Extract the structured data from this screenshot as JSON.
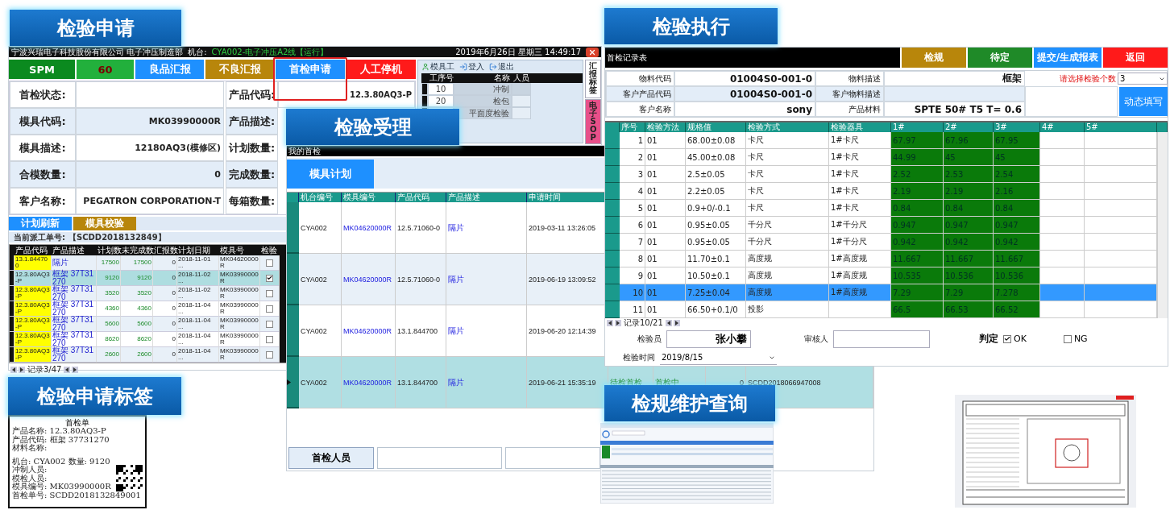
{
  "apply_screen": {
    "label": "检验申请",
    "company": "宁波兴瑞电子科技股份有限公司  电子冲压制造部",
    "machine_label": "机台:",
    "machine": "CYA002-电子冲压A2线【运行】",
    "datetime": "2019年6月26日 星期三 14:49:17",
    "actions": [
      {
        "text": "SPM",
        "kind": "status",
        "highlighted": false
      },
      {
        "text": "60",
        "kind": "value",
        "highlighted": false
      },
      {
        "text": "良品汇报",
        "kind": "good",
        "highlighted": false
      },
      {
        "text": "不良汇报",
        "kind": "bad",
        "highlighted": false
      },
      {
        "text": "首检申请",
        "kind": "apply",
        "highlighted": true
      },
      {
        "text": "人工停机",
        "kind": "stop",
        "highlighted": false
      }
    ],
    "info_left": [
      {
        "label": "首检状态:"
      },
      {
        "label": "模具代码:",
        "value": "MK03990000R"
      },
      {
        "label": "模具描述:",
        "value": "12180AQ3(模修区)"
      },
      {
        "label": "合模数量:",
        "value": "0"
      },
      {
        "label": "客户名称:",
        "value": "PEGATRON CORPORATION-T"
      }
    ],
    "info_right": [
      {
        "label": "产品代码:",
        "value": "12.3.80AQ3-P"
      },
      {
        "label": "产品描述:"
      },
      {
        "label": "计划数量:"
      },
      {
        "label": "完成数量:"
      },
      {
        "label": "每箱数量:"
      }
    ],
    "process_panel": {
      "toolbar": [
        "模具工",
        "登入",
        "退出"
      ],
      "columns": [
        "工序号",
        "名称",
        "人员"
      ],
      "rows": [
        {
          "step": "10",
          "name": "冲制"
        },
        {
          "step": "20",
          "name": "检包"
        },
        {
          "name": "平面度检验"
        }
      ]
    },
    "side_tabs": [
      {
        "text": "汇报标签",
        "color": "#ffffff"
      },
      {
        "text": "电子SOP",
        "color": "#e8508a"
      }
    ],
    "plan_buttons": [
      {
        "text": "计划刷新",
        "kind": "refresh"
      },
      {
        "text": "模具校验",
        "kind": "check"
      }
    ],
    "dispatch_label": "当前派工单号:",
    "dispatch_no": "【SCDD2018132849】",
    "plan_columns": [
      "产品代码",
      "产品描述",
      "计划数",
      "未完成数",
      "汇报数",
      "计划日期",
      "模具号",
      "检验"
    ],
    "plan_rows": [
      {
        "code": "13.1.844700",
        "desc": "隔片",
        "plan": "17500",
        "remaining": "17500",
        "reported": "0",
        "date": "2018-11-01 ...",
        "mold": "MK04620000R",
        "checked": false,
        "selected": false
      },
      {
        "code": "12.3.80AQ3-P",
        "desc": "框架 37T31270",
        "plan": "9120",
        "remaining": "9120",
        "reported": "0",
        "date": "2018-11-02 ...",
        "mold": "MK03990000R",
        "checked": true,
        "selected": true
      },
      {
        "code": "12.3.80AQ3-P",
        "desc": "框架 37T31270",
        "plan": "3520",
        "remaining": "3520",
        "reported": "0",
        "date": "2018-11-02 ...",
        "mold": "MK03990000R",
        "checked": false,
        "selected": false
      },
      {
        "code": "12.3.80AQ3-P",
        "desc": "框架 37T31270",
        "plan": "4360",
        "remaining": "4360",
        "reported": "0",
        "date": "2018-11-04 ...",
        "mold": "MK03990000R",
        "checked": false,
        "selected": false
      },
      {
        "code": "12.3.80AQ3-P",
        "desc": "框架 37T31270",
        "plan": "5600",
        "remaining": "5600",
        "reported": "0",
        "date": "2018-11-04 ...",
        "mold": "MK03990000R",
        "checked": false,
        "selected": false
      },
      {
        "code": "12.3.80AQ3-P",
        "desc": "框架 37T31270",
        "plan": "8620",
        "remaining": "8620",
        "reported": "0",
        "date": "2018-11-04 ...",
        "mold": "MK03990000R",
        "checked": false,
        "selected": false
      },
      {
        "code": "12.3.80AQ3-P",
        "desc": "框架 37T31270",
        "plan": "2600",
        "remaining": "2600",
        "reported": "0",
        "date": "2018-11-04 ...",
        "mold": "MK03990000R",
        "checked": false,
        "selected": false
      }
    ],
    "pager": "记录3/47"
  },
  "accept_screen": {
    "label": "检验受理",
    "title": "我的首检",
    "tab": "模具计划",
    "columns": [
      "机台编号",
      "模具编号",
      "产品代码",
      "产品描述",
      "申请时间"
    ],
    "rows": [
      {
        "machine": "CYA002",
        "mold": "MK04620000R",
        "code": "12.5.71060-0",
        "desc": "隔片",
        "time": "2019-03-11 13:26:05",
        "selected": false
      },
      {
        "machine": "CYA002",
        "mold": "MK04620000R",
        "code": "12.5.71060-0",
        "desc": "隔片",
        "time": "2019-06-19 13:09:52",
        "selected": false
      },
      {
        "machine": "CYA002",
        "mold": "MK04620000R",
        "code": "13.1.844700",
        "desc": "隔片",
        "time": "2019-06-20 12:14:39",
        "selected": false
      },
      {
        "machine": "CYA002",
        "mold": "MK04620000R",
        "code": "13.1.844700",
        "desc": "隔片",
        "time": "2019-06-21 15:35:19",
        "selected": true,
        "extra": [
          "待检首检",
          "首检中",
          "0",
          "SCDD2018066947008"
        ]
      }
    ],
    "inspector_button": "首检人员"
  },
  "exec_screen": {
    "label": "检验执行",
    "title": "首检记录表",
    "buttons": [
      {
        "text": "检规",
        "kind": "gauge"
      },
      {
        "text": "待定",
        "kind": "pending"
      },
      {
        "text": "提交/生成报表",
        "kind": "submit"
      },
      {
        "text": "返回",
        "kind": "back"
      }
    ],
    "info": [
      {
        "label": "物料代码",
        "value": "01004S0-001-0",
        "label2": "物料描述",
        "value2": "框架"
      },
      {
        "label": "客户产品代码",
        "value": "01004S0-001-0",
        "label2": "客户物料描述"
      },
      {
        "label": "客户名称",
        "value": "sony",
        "label2": "产品材料",
        "value2": "SPTE  50# T5  T= 0.6"
      }
    ],
    "count_label": "请选择检验个数",
    "count_value": "3",
    "fill_button": "动态填写",
    "columns": [
      "序号",
      "检验方法",
      "规格值",
      "检验方式",
      "检验器具",
      "1#",
      "2#",
      "3#",
      "4#",
      "5#"
    ],
    "rows": [
      {
        "no": "1",
        "method": "01",
        "spec": "68.00±0.08",
        "way": "卡尺",
        "tool": "1#卡尺",
        "values": [
          "67.97",
          "67.96",
          "67.95"
        ],
        "selected": false
      },
      {
        "no": "2",
        "method": "01",
        "spec": "45.00±0.08",
        "way": "卡尺",
        "tool": "1#卡尺",
        "values": [
          "44.99",
          "45",
          "45"
        ],
        "selected": false
      },
      {
        "no": "3",
        "method": "01",
        "spec": "2.5±0.05",
        "way": "卡尺",
        "tool": "1#卡尺",
        "values": [
          "2.52",
          "2.53",
          "2.54"
        ],
        "selected": false
      },
      {
        "no": "4",
        "method": "01",
        "spec": "2.2±0.05",
        "way": "卡尺",
        "tool": "1#卡尺",
        "values": [
          "2.19",
          "2.19",
          "2.16"
        ],
        "selected": false
      },
      {
        "no": "5",
        "method": "01",
        "spec": "0.9+0/-0.1",
        "way": "卡尺",
        "tool": "1#卡尺",
        "values": [
          "0.84",
          "0.84",
          "0.84"
        ],
        "selected": false
      },
      {
        "no": "6",
        "method": "01",
        "spec": "0.95±0.05",
        "way": "千分尺",
        "tool": "1#千分尺",
        "values": [
          "0.947",
          "0.947",
          "0.947"
        ],
        "selected": false
      },
      {
        "no": "7",
        "method": "01",
        "spec": "0.95±0.05",
        "way": "千分尺",
        "tool": "1#千分尺",
        "values": [
          "0.942",
          "0.942",
          "0.942"
        ],
        "selected": false
      },
      {
        "no": "8",
        "method": "01",
        "spec": "11.70±0.1",
        "way": "高度规",
        "tool": "1#高度规",
        "values": [
          "11.667",
          "11.667",
          "11.667"
        ],
        "selected": false
      },
      {
        "no": "9",
        "method": "01",
        "spec": "10.50±0.1",
        "way": "高度规",
        "tool": "1#高度规",
        "values": [
          "10.535",
          "10.536",
          "10.536"
        ],
        "selected": false
      },
      {
        "no": "10",
        "method": "01",
        "spec": "7.25±0.04",
        "way": "高度规",
        "tool": "1#高度规",
        "values": [
          "7.29",
          "7.29",
          "7.278"
        ],
        "selected": true
      },
      {
        "no": "11",
        "method": "01",
        "spec": "66.50+0.1/0",
        "way": "投影",
        "values": [
          "66.5",
          "66.53",
          "66.52"
        ],
        "selected": false
      }
    ],
    "pager": "记录10/21",
    "inspector_label": "检验员",
    "inspector": "张小攀",
    "reviewer_label": "审核人",
    "time_label": "检验时间",
    "time_value": "2019/8/15",
    "verdict_label": "判定",
    "verdict_options": [
      {
        "text": "OK",
        "checked": true
      },
      {
        "text": "NG",
        "checked": false
      }
    ]
  },
  "label_card": {
    "label": "检验申请标签",
    "title": "首检单",
    "top_lines": [
      "产品名称: 12.3.80AQ3-P",
      "产品代码: 框架 37731270",
      "材料名称:"
    ],
    "bottom_lines": [
      "机台: CYA002   数量: 9120",
      "冲制人员:",
      "模检人员:",
      "模具编号: MK03990000R"
    ],
    "order_line": "首检单号: SCDD2018132849001"
  },
  "query_screen": {
    "label": "检规维护查询"
  }
}
